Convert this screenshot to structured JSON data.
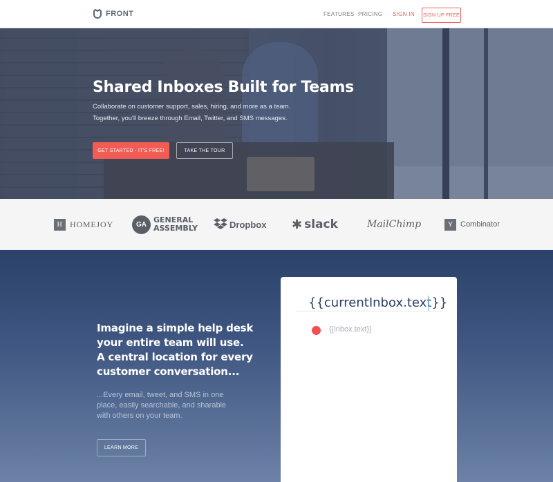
{
  "nav": {
    "logo_text": "FRONT",
    "links": [
      "FEATURES",
      "PRICING",
      "SIGN IN"
    ],
    "signup_label": "SIGN UP FREE"
  },
  "hero": {
    "title": "Shared Inboxes Built for Teams",
    "subtitle_line1": "Collaborate on customer support, sales, hiring, and more as a team.",
    "subtitle_line2": "Together, you'll breeze through Email, Twitter, and SMS messages.",
    "cta_label": "GET STARTED - IT'S FREE!",
    "tour_label": "TAKE THE TOUR"
  },
  "logos": {
    "homejoy": {
      "mark": "H",
      "text": "HOMEJOY"
    },
    "general_assembly": {
      "mark": "GA",
      "line1": "GENERAL",
      "line2": "ASSEMBLY"
    },
    "dropbox": "Dropbox",
    "slack": "slack",
    "mailchimp": "MailChimp",
    "ycombinator": {
      "mark": "Y",
      "text": "Combinator"
    }
  },
  "feature": {
    "heading_line1": "Imagine a simple help desk",
    "heading_line2": "your entire team will use.",
    "heading_line3": "A central location for every",
    "heading_line4": "customer conversation...",
    "sub_line1": "...Every email, tweet, and SMS in one",
    "sub_line2": "place, easily searchable, and sharable",
    "sub_line3": "with others on your team.",
    "learn_more_label": "LEARN MORE"
  },
  "card": {
    "title": "{{currentInbox.text}}",
    "item": "{{inbox.text}}"
  },
  "colors": {
    "accent": "#f25c55",
    "navy": "#2b4269",
    "dot": "#f24f4f"
  }
}
